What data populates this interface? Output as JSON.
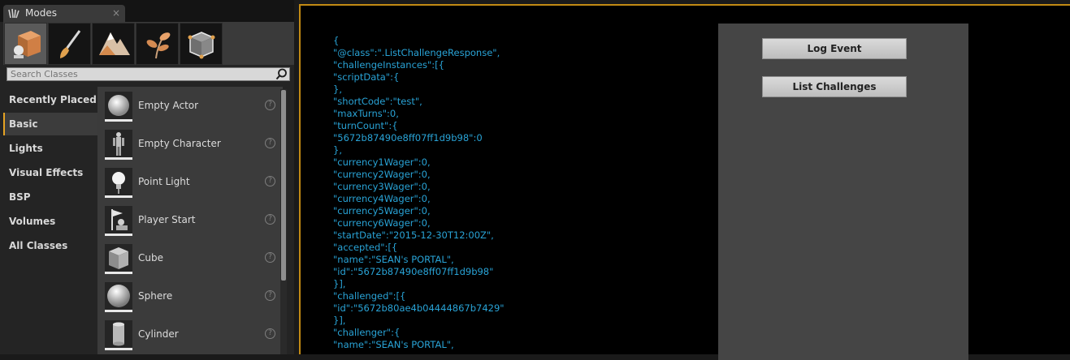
{
  "modes_panel": {
    "tab_title": "Modes",
    "close_glyph": "×",
    "tools": [
      {
        "icon": "place-mode-icon"
      },
      {
        "icon": "paint-mode-icon"
      },
      {
        "icon": "landscape-mode-icon"
      },
      {
        "icon": "foliage-mode-icon"
      },
      {
        "icon": "geometry-mode-icon"
      }
    ],
    "search": {
      "placeholder": "Search Classes"
    },
    "categories": [
      {
        "label": "Recently Placed"
      },
      {
        "label": "Basic"
      },
      {
        "label": "Lights"
      },
      {
        "label": "Visual Effects"
      },
      {
        "label": "BSP"
      },
      {
        "label": "Volumes"
      },
      {
        "label": "All Classes"
      }
    ],
    "selected_category": "Basic",
    "items": [
      {
        "label": "Empty Actor",
        "icon": "empty-actor-icon"
      },
      {
        "label": "Empty Character",
        "icon": "empty-character-icon"
      },
      {
        "label": "Point Light",
        "icon": "point-light-icon"
      },
      {
        "label": "Player Start",
        "icon": "player-start-icon"
      },
      {
        "label": "Cube",
        "icon": "cube-icon"
      },
      {
        "label": "Sphere",
        "icon": "sphere-icon"
      },
      {
        "label": "Cylinder",
        "icon": "cylinder-icon"
      }
    ],
    "help_glyph": "?"
  },
  "viewport": {
    "json_lines": [
      "{",
      "\"@class\":\".ListChallengeResponse\",",
      "\"challengeInstances\":[{",
      "\"scriptData\":{",
      "},",
      "\"shortCode\":\"test\",",
      "\"maxTurns\":0,",
      "\"turnCount\":{",
      "\"5672b87490e8ff07ff1d9b98\":0",
      "},",
      "\"currency1Wager\":0,",
      "\"currency2Wager\":0,",
      "\"currency3Wager\":0,",
      "\"currency4Wager\":0,",
      "\"currency5Wager\":0,",
      "\"currency6Wager\":0,",
      "\"startDate\":\"2015-12-30T12:00Z\",",
      "\"accepted\":[{",
      "\"name\":\"SEAN's PORTAL\",",
      "\"id\":\"5672b87490e8ff07ff1d9b98\"",
      "}],",
      "\"challenged\":[{",
      "\"id\":\"5672b80ae4b04444867b7429\"",
      "}],",
      "\"challenger\":{",
      "\"name\":\"SEAN's PORTAL\","
    ],
    "buttons": {
      "log_event": "Log Event",
      "list_challenges": "List Challenges"
    }
  },
  "colors": {
    "json_text": "#29a3d6",
    "viewport_border": "#c28a14",
    "selected_category_accent": "#e5a323"
  }
}
